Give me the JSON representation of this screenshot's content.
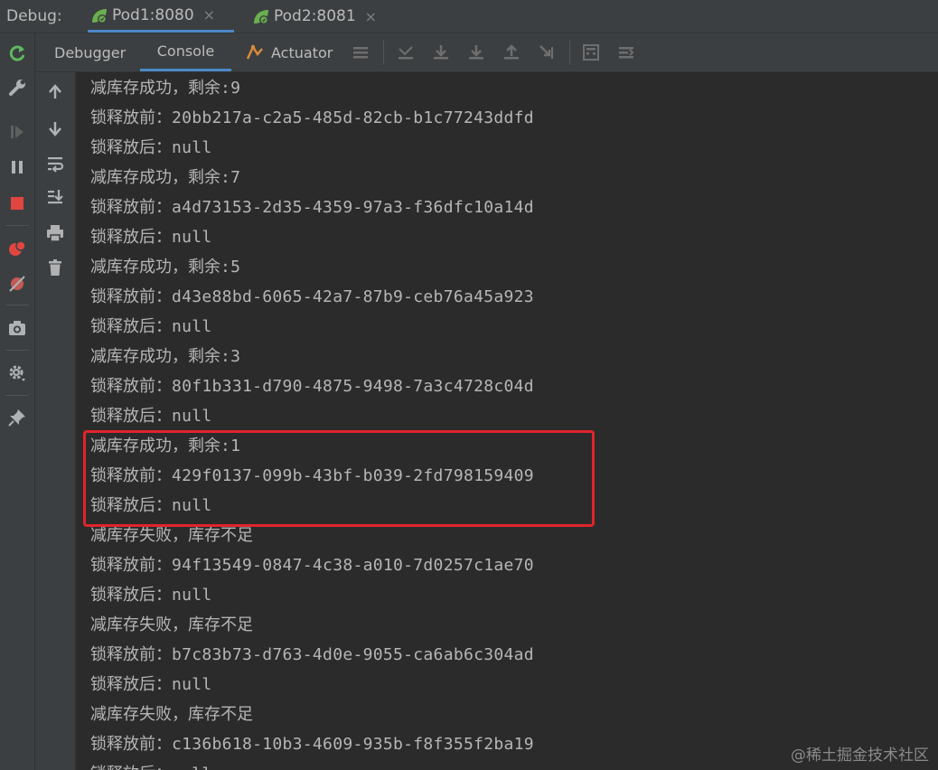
{
  "header": {
    "debug_label": "Debug:",
    "tabs": [
      {
        "label": "Pod1:8080",
        "close": "×"
      },
      {
        "label": "Pod2:8081",
        "close": "×"
      }
    ]
  },
  "toolbar": {
    "tabs": [
      "Debugger",
      "Console",
      "Actuator"
    ]
  },
  "console": {
    "lines": [
      {
        "prefix": "减库存成功，剩余",
        "value": ":9"
      },
      {
        "prefix": "锁释放前：",
        "value": "20bb217a-c2a5-485d-82cb-b1c77243ddfd"
      },
      {
        "prefix": "锁释放后：",
        "value": "null"
      },
      {
        "prefix": "减库存成功，剩余",
        "value": ":7"
      },
      {
        "prefix": "锁释放前：",
        "value": "a4d73153-2d35-4359-97a3-f36dfc10a14d"
      },
      {
        "prefix": "锁释放后：",
        "value": "null"
      },
      {
        "prefix": "减库存成功，剩余",
        "value": ":5"
      },
      {
        "prefix": "锁释放前：",
        "value": "d43e88bd-6065-42a7-87b9-ceb76a45a923"
      },
      {
        "prefix": "锁释放后：",
        "value": "null"
      },
      {
        "prefix": "减库存成功，剩余",
        "value": ":3"
      },
      {
        "prefix": "锁释放前：",
        "value": "80f1b331-d790-4875-9498-7a3c4728c04d"
      },
      {
        "prefix": "锁释放后：",
        "value": "null"
      },
      {
        "prefix": "减库存成功，剩余",
        "value": ":1"
      },
      {
        "prefix": "锁释放前：",
        "value": "429f0137-099b-43bf-b039-2fd798159409"
      },
      {
        "prefix": "锁释放后：",
        "value": "null"
      },
      {
        "prefix": "减库存失败，库存不足",
        "value": ""
      },
      {
        "prefix": "锁释放前：",
        "value": "94f13549-0847-4c38-a010-7d0257c1ae70"
      },
      {
        "prefix": "锁释放后：",
        "value": "null"
      },
      {
        "prefix": "减库存失败，库存不足",
        "value": ""
      },
      {
        "prefix": "锁释放前：",
        "value": "b7c83b73-d763-4d0e-9055-ca6ab6c304ad"
      },
      {
        "prefix": "锁释放后：",
        "value": "null"
      },
      {
        "prefix": "减库存失败，库存不足",
        "value": ""
      },
      {
        "prefix": "锁释放前：",
        "value": "c136b618-10b3-4609-935b-f8f355f2ba19"
      },
      {
        "prefix": "锁释放后：",
        "value": "null"
      }
    ]
  },
  "watermark": "@稀土掘金技术社区",
  "colors": {
    "accent": "#4a88c7",
    "highlight": "#e0242b",
    "spring_green": "#6aaf50"
  },
  "icons": {
    "left_bar": [
      "rerun-icon",
      "wrench-icon",
      "resume-icon",
      "pause-icon",
      "stop-icon",
      "view-breakpoints-icon",
      "mute-breakpoints-icon",
      "camera-icon",
      "settings-icon",
      "pin-icon"
    ],
    "gutter": [
      "up-arrow-icon",
      "down-arrow-icon",
      "soft-wrap-icon",
      "scroll-to-end-icon",
      "print-icon",
      "trash-icon"
    ]
  }
}
